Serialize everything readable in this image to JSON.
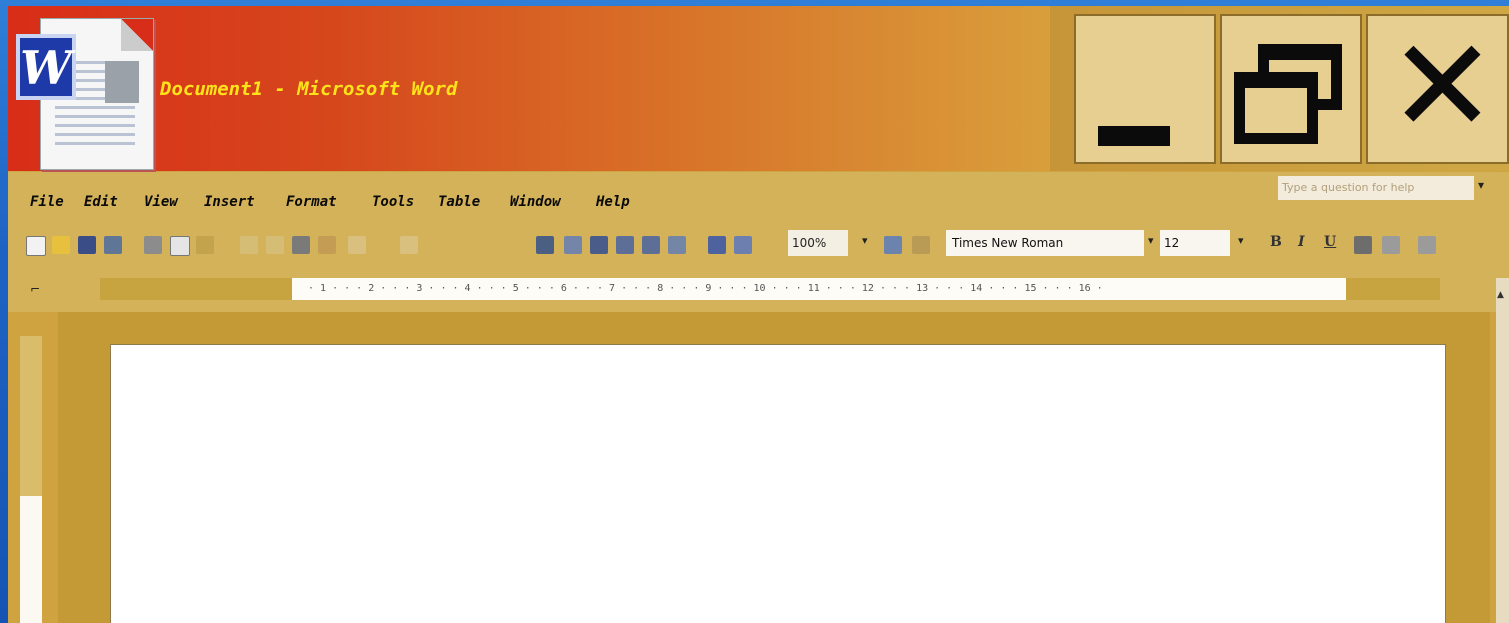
{
  "window": {
    "title": "Document1 - Microsoft Word",
    "app_icon_letter": "W"
  },
  "window_controls": {
    "minimize_icon": "minimize-icon",
    "restore_icon": "restore-icon",
    "close_icon": "close-icon"
  },
  "menu": {
    "items": [
      "File",
      "Edit",
      "View",
      "Insert",
      "Format",
      "Tools",
      "Table",
      "Window",
      "Help"
    ]
  },
  "help_search": {
    "placeholder": "Type a question for help"
  },
  "toolbar": {
    "zoom": "100%",
    "font_name": "Times New Roman",
    "font_size": "12",
    "bold": "B",
    "italic": "I",
    "underline": "U"
  },
  "ruler": {
    "ticks": "· 1 · · · 2 · · · 3 · · · 4 · · · 5 · · · 6 · · · 7 · · · 8 · · · 9 · · · 10 · · · 11 · · · 12 · · · 13 · · · 14 · · · 15 · · · 16 ·"
  },
  "colors": {
    "title_gradient_start": "#d82d18",
    "title_gradient_end": "#d9a23d",
    "title_text": "#ffe21a",
    "chrome": "#d4b25a",
    "page": "#ffffff"
  }
}
